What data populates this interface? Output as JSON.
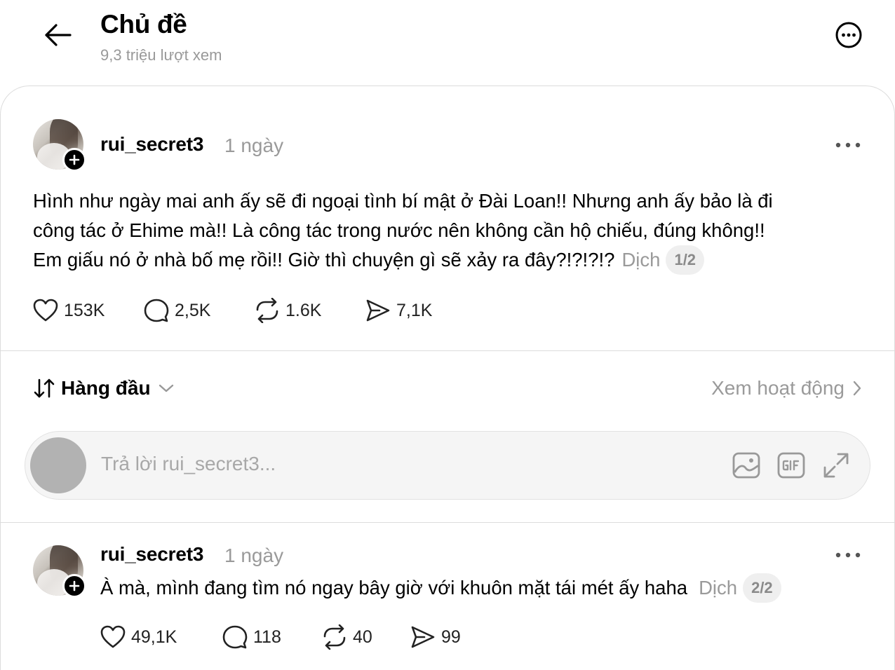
{
  "header": {
    "title": "Chủ đề",
    "views": "9,3 triệu lượt xem"
  },
  "post": {
    "username": "rui_secret3",
    "time": "1 ngày",
    "text_line1": "Hình như ngày mai anh ấy sẽ đi ngoại tình bí mật ở Đài Loan!! Nhưng anh ấy bảo là đi",
    "text_line2": "công tác ở Ehime mà!! Là công tác trong nước nên không cần hộ chiếu, đúng không!!",
    "text_line3": "Em giấu nó ở nhà bố mẹ rồi!! Giờ thì chuyện gì sẽ xảy ra đây?!?!?!?",
    "translate": "Dịch",
    "pager": "1/2",
    "likes": "153K",
    "replies": "2,5K",
    "reposts": "1.6K",
    "shares": "7,1K"
  },
  "sort": {
    "label": "Hàng đầu",
    "activity": "Xem hoạt động"
  },
  "reply_box": {
    "placeholder": "Trả lời rui_secret3..."
  },
  "comment": {
    "username": "rui_secret3",
    "time": "1 ngày",
    "text": "À mà, mình đang tìm nó ngay bây giờ với khuôn mặt tái mét ấy haha",
    "translate": "Dịch",
    "pager": "2/2",
    "likes": "49,1K",
    "replies": "118",
    "reposts": "40",
    "shares": "99"
  },
  "icons": {
    "back": "arrow-left-icon",
    "more": "more-circle-icon",
    "heart": "heart-icon",
    "reply": "comment-bubble-icon",
    "repost": "repost-icon",
    "share": "send-icon",
    "image": "image-icon",
    "gif": "gif-icon",
    "expand": "expand-icon"
  }
}
